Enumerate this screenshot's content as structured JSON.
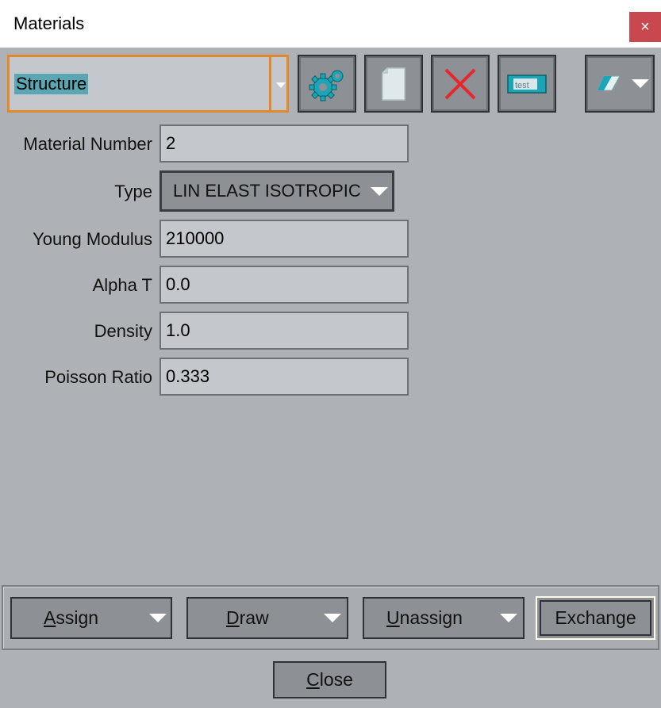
{
  "window": {
    "title": "Materials",
    "close_glyph": "×"
  },
  "selector": {
    "value": "Structure"
  },
  "toolbar": {
    "icons": [
      "gears-icon",
      "new-page-icon",
      "delete-x-icon",
      "test-material-icon",
      "eraser-icon"
    ],
    "accent": "#1aa6b6",
    "delete_color": "#e8262b",
    "test_text": "test"
  },
  "form": {
    "material_number_label": "Material Number",
    "material_number": "2",
    "type_label": "Type",
    "type_value": "LIN ELAST ISOTROPIC",
    "young_label": "Young Modulus",
    "young_value": "210000",
    "alpha_label": "Alpha T",
    "alpha_value": "0.0",
    "density_label": "Density",
    "density_value": "1.0",
    "poisson_label": "Poisson Ratio",
    "poisson_value": "0.333"
  },
  "actions": {
    "assign": {
      "mnemonic": "A",
      "rest": "ssign"
    },
    "draw": {
      "mnemonic": "D",
      "rest": "raw"
    },
    "unassign": {
      "mnemonic": "U",
      "rest": "nassign"
    },
    "exchange": "Exchange"
  },
  "footer": {
    "close_mnemonic": "C",
    "close_rest": "lose"
  },
  "colors": {
    "background": "#aeb1b5",
    "selection_border": "#e0882c",
    "close_red": "#c9484f"
  }
}
